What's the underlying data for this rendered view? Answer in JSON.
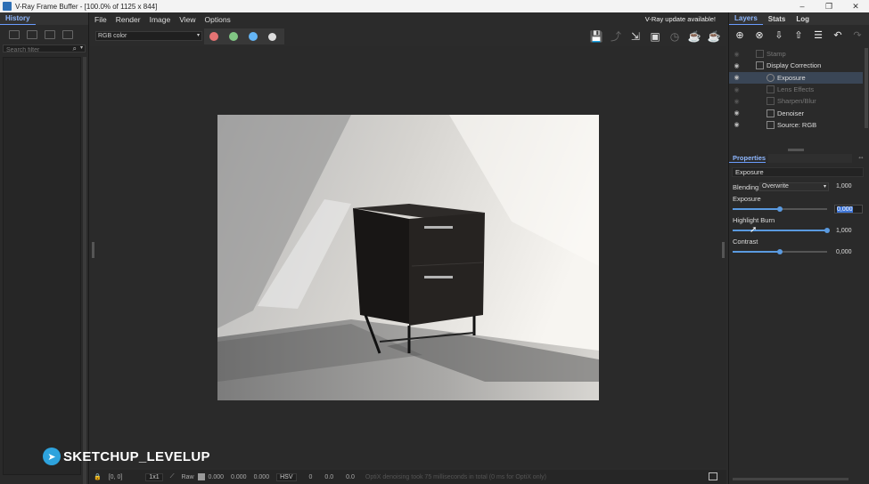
{
  "window": {
    "title": "V-Ray Frame Buffer - [100.0% of 1125 x 844]",
    "controls": [
      "–",
      "❐",
      "✕"
    ]
  },
  "left_panel": {
    "tab": "History",
    "search_placeholder": "Search filter"
  },
  "menu": {
    "items": [
      "File",
      "Render",
      "Image",
      "View",
      "Options"
    ],
    "notice": "V-Ray update available!"
  },
  "toolbar": {
    "channel": "RGB color",
    "color_buttons": {
      "red": "#e57373",
      "green": "#81c784",
      "blue": "#64b5f6"
    }
  },
  "right_panel": {
    "tabs": [
      "Layers",
      "Stats",
      "Log"
    ],
    "layers": [
      {
        "name": "Stamp",
        "visible": false,
        "indent": 1
      },
      {
        "name": "Display Correction",
        "visible": true,
        "indent": 1
      },
      {
        "name": "Exposure",
        "visible": true,
        "indent": 2,
        "selected": true
      },
      {
        "name": "Lens Effects",
        "visible": false,
        "indent": 2
      },
      {
        "name": "Sharpen/Blur",
        "visible": false,
        "indent": 2
      },
      {
        "name": "Denoiser",
        "visible": true,
        "indent": 2
      },
      {
        "name": "Source: RGB",
        "visible": true,
        "indent": 2
      }
    ],
    "properties": {
      "header": "Properties",
      "layer_name": "Exposure",
      "blending_label": "Blending",
      "blending_mode": "Overwrite",
      "blending_value": "1,000",
      "exposure_label": "Exposure",
      "exposure_value": "0,000",
      "exposure_level": 0.5,
      "highlight_burn_label": "Highlight Burn",
      "highlight_burn_value": "1,000",
      "highlight_burn_level": 1.0,
      "contrast_label": "Contrast",
      "contrast_value": "0,000",
      "contrast_level": 0.5
    }
  },
  "status": {
    "coords": "[0, 0]",
    "ratio": "1x1",
    "raw": "Raw",
    "rgb": [
      "0.000",
      "0.000",
      "0.000"
    ],
    "space": "HSV",
    "hsv": [
      "0",
      "0.0",
      "0.0"
    ],
    "message": "OptiX denoising took 75 milliseconds in total (0 ms for OptiX only)"
  },
  "watermark": "SKETCHUP_LEVELUP"
}
